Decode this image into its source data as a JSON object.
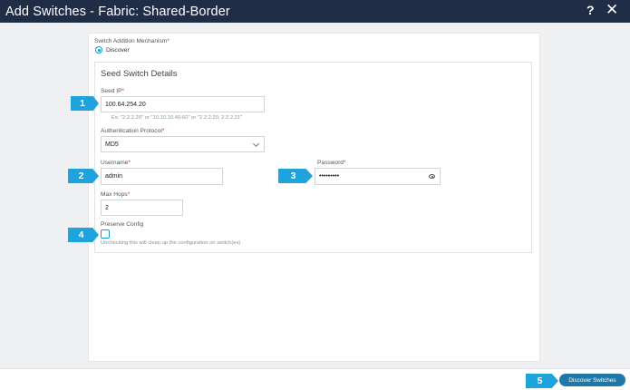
{
  "title": "Add Switches - Fabric: Shared-Border",
  "header": {
    "help_icon": "?",
    "close_icon": "✕"
  },
  "mechanism": {
    "label": "Switch Addition Mechanism",
    "required": "*",
    "option": "Discover"
  },
  "seed": {
    "title": "Seed Switch Details",
    "ip_label": "Seed IP",
    "ip_value": "100.64.254.20",
    "ip_hint": "Ex: \"2.2.2.20\" or \"10.10.10.40-60\" or \"2.2.2.20, 2.2.2.21\"",
    "auth_label": "Authentication Protocol",
    "auth_value": "MD5",
    "username_label": "Username",
    "username_value": "admin",
    "password_label": "Password",
    "password_value": "•••••••••",
    "hops_label": "Max Hops",
    "hops_value": "2",
    "preserve_label": "Preserve Config",
    "preserve_hint": "Unchecking this will clean up the configuration on switch(es)"
  },
  "callouts": [
    "1",
    "2",
    "3",
    "4",
    "5"
  ],
  "footer": {
    "discover_label": "Discover Switches"
  },
  "colors": {
    "titlebar": "#1f2d46",
    "accent": "#049fd9",
    "callout": "#1fa3dc",
    "button": "#1e78a8"
  }
}
